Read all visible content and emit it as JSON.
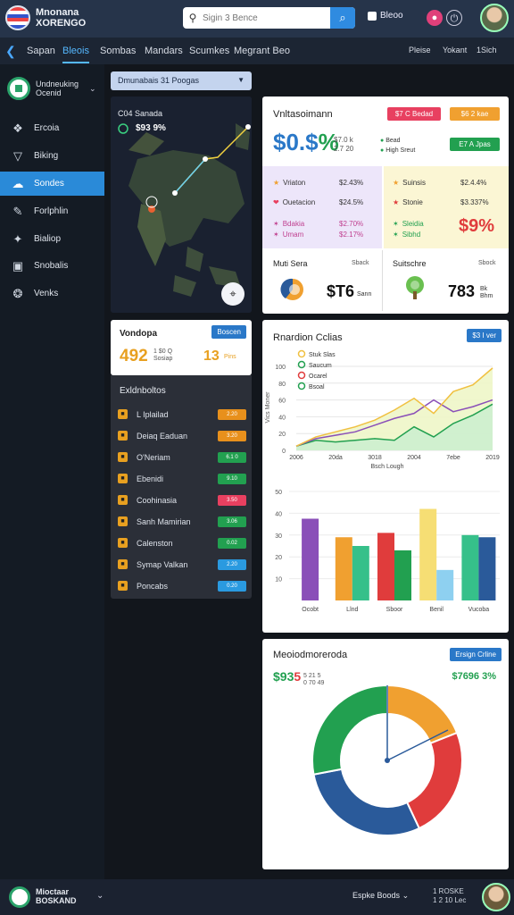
{
  "brand": {
    "line1": "Mnonana",
    "line2": "XORENGO"
  },
  "search": {
    "placeholder": "Sigin 3 Bence",
    "icon": "search-icon"
  },
  "header": {
    "blog_label": "Bleoo",
    "avatar": "user-avatar"
  },
  "nav": {
    "tabs": [
      "Sapan",
      "Bleois",
      "Sombas",
      "Mandars",
      "Scumkes",
      "Megrant Beo"
    ],
    "right": [
      "Pleise",
      "Yokant",
      "1Sich"
    ]
  },
  "sidebar": {
    "title_line1": "Undneuking",
    "title_line2": "Ocenid",
    "items": [
      {
        "label": "Ercoia",
        "icon": "feather-icon"
      },
      {
        "label": "Biking",
        "icon": "funnel-icon"
      },
      {
        "label": "Sondes",
        "icon": "cloud-icon"
      },
      {
        "label": "Forlphlin",
        "icon": "pen-icon"
      },
      {
        "label": "Bialiop",
        "icon": "puzzle-icon"
      },
      {
        "label": "Snobalis",
        "icon": "image-icon"
      },
      {
        "label": "Venks",
        "icon": "globe-icon"
      }
    ]
  },
  "dropdown": {
    "label": "Dmunabais 31 Poogas"
  },
  "map": {
    "label": "C04 Sanada",
    "value": "$93 9%"
  },
  "vendors": {
    "title": "Vondopa",
    "button": "Boscen",
    "value1": "492",
    "sub1_line1": "1 $0 Q",
    "sub1_line2": "Sosiap",
    "value2": "13",
    "sub2": "Pins"
  },
  "exhibitions": {
    "title": "Exldnboltos",
    "rows": [
      {
        "label": "L Iplailad",
        "badge": "2.20",
        "color": "#e8901c"
      },
      {
        "label": "Deiaq Eaduan",
        "badge": "3.20",
        "color": "#e8901c"
      },
      {
        "label": "O'Neriam",
        "badge": "6.1 0",
        "color": "#22a050"
      },
      {
        "label": "Ebenidi",
        "badge": "9.10",
        "color": "#22a050"
      },
      {
        "label": "Coohinasia",
        "badge": "3.50",
        "color": "#e84060"
      },
      {
        "label": "Sanh Mamirian",
        "badge": "3.06",
        "color": "#22a050"
      },
      {
        "label": "Calenston",
        "badge": "0.02",
        "color": "#22a050"
      },
      {
        "label": "Symap Valkan",
        "badge": "2.20",
        "color": "#2a9ae0"
      },
      {
        "label": "Poncabs",
        "badge": "0.20",
        "color": "#2a9ae0"
      }
    ]
  },
  "marketing": {
    "title": "Vnltasoimann",
    "pill1": "$7 C Bedad",
    "pill2": "$6 2 kae",
    "pill3": "E7 A Jpas",
    "big_prefix": "$0.$",
    "big_pct": "%",
    "sub_line1": "$7.0 k",
    "sub_line2": "2.7 20",
    "legend1": "Bead",
    "legend2": "High Sreut",
    "q_rows_left": [
      {
        "label": "Vriaton",
        "value": "$2.43%"
      },
      {
        "label": "Ouetacion",
        "value": "$24.5%"
      },
      {
        "label": "Bdakia",
        "value": "$2.70%"
      },
      {
        "label": "Umam",
        "value": "$2.17%"
      }
    ],
    "q_rows_right": [
      {
        "label": "Suinsis",
        "value": "$2.4.4%"
      },
      {
        "label": "Stonie",
        "value": "$3.337%"
      },
      {
        "label": "Sleidia",
        "value": ""
      },
      {
        "label": "Sibhd",
        "value": ""
      }
    ],
    "big_right": "$9%",
    "stat_left_title": "Muti Sera",
    "stat_left_book": "Sback",
    "stat_left_value": "$T6",
    "stat_left_unit": "Sann",
    "stat_right_title": "Suitschre",
    "stat_right_book": "Sbock",
    "stat_right_value": "783",
    "stat_right_unit1": "Bk",
    "stat_right_unit2": "Bhm"
  },
  "charts_card": {
    "title": "Rnardion Cclias",
    "button": "$3 I ver"
  },
  "chart_data": [
    {
      "type": "area",
      "title": "Rnardion Cclias",
      "xlabel": "Bsch Lough",
      "ylabel": "Vics Moner",
      "ylim": [
        0,
        100
      ],
      "yticks": [
        0,
        20,
        40,
        60,
        80,
        100
      ],
      "x_ticks": [
        "2006",
        "20da",
        "3018",
        "2004",
        "7ebe",
        "2019"
      ],
      "legend": [
        "Stuk Slas",
        "Saucum",
        "Ocarel",
        "Bsoal"
      ],
      "series": [
        {
          "name": "Saucum",
          "color": "#22a050",
          "values": [
            5,
            12,
            10,
            12,
            14,
            12,
            28,
            16,
            32,
            42,
            55
          ]
        },
        {
          "name": "Ocarel",
          "color": "#8a4fb8",
          "values": [
            5,
            14,
            18,
            22,
            30,
            38,
            44,
            60,
            46,
            52,
            60
          ]
        },
        {
          "name": "Stuk Slas",
          "color": "#f0c040",
          "values": [
            5,
            16,
            22,
            28,
            36,
            48,
            62,
            44,
            70,
            78,
            98
          ]
        }
      ]
    },
    {
      "type": "bar",
      "ylim": [
        0,
        50
      ],
      "yticks": [
        10,
        20,
        30,
        40,
        50
      ],
      "categories": [
        "Ocobt",
        "Llnd",
        "Sboor",
        "Benil",
        "Vucoba"
      ],
      "series": [
        {
          "name": "Sanir",
          "color": "#8a4fb8",
          "values": [
            37.5,
            0,
            0,
            0,
            0
          ]
        },
        {
          "name": "Orange",
          "color": "#f0a030",
          "values": [
            0,
            29,
            0,
            0,
            0
          ]
        },
        {
          "name": "Teal",
          "color": "#36c08a",
          "values": [
            0,
            25,
            0,
            0,
            30
          ]
        },
        {
          "name": "Red",
          "color": "#e03c3c",
          "values": [
            0,
            0,
            31,
            0,
            0
          ]
        },
        {
          "name": "Green",
          "color": "#22a050",
          "values": [
            0,
            0,
            23,
            0,
            0
          ]
        },
        {
          "name": "Yellow",
          "color": "#f6de74",
          "values": [
            0,
            0,
            0,
            42,
            0
          ]
        },
        {
          "name": "Sky",
          "color": "#8ed0f0",
          "values": [
            0,
            0,
            0,
            14,
            0
          ]
        },
        {
          "name": "Blue",
          "color": "#2a5a9a",
          "values": [
            0,
            0,
            0,
            0,
            29
          ]
        }
      ]
    },
    {
      "type": "pie",
      "title": "Meoiodmoreroda",
      "slices": [
        {
          "label": "Orange",
          "color": "#f0a030",
          "value": 19
        },
        {
          "label": "Red",
          "color": "#e03c3c",
          "value": 24
        },
        {
          "label": "Blue",
          "color": "#2a5a9a",
          "value": 29
        },
        {
          "label": "Green",
          "color": "#22a050",
          "value": 28
        }
      ]
    }
  ],
  "donut_card": {
    "title": "Meoiodmoreroda",
    "button": "Ersign Crline",
    "v1_green": "$93",
    "v1_red": "5",
    "s1_line1": "5 21 5",
    "s1_line2": "0 70 49",
    "v2": "$7696 3%"
  },
  "footer": {
    "brand_line1": "Mioctaar",
    "brand_line2": "BOSKAND",
    "select": "Espke Boods",
    "info_line1": "1 ROSKE",
    "info_line2": "1 2 10 Lec"
  },
  "colors": {
    "accent": "#2a8ad8",
    "green": "#22a050",
    "orange": "#e8a020",
    "red": "#e03c3c"
  }
}
